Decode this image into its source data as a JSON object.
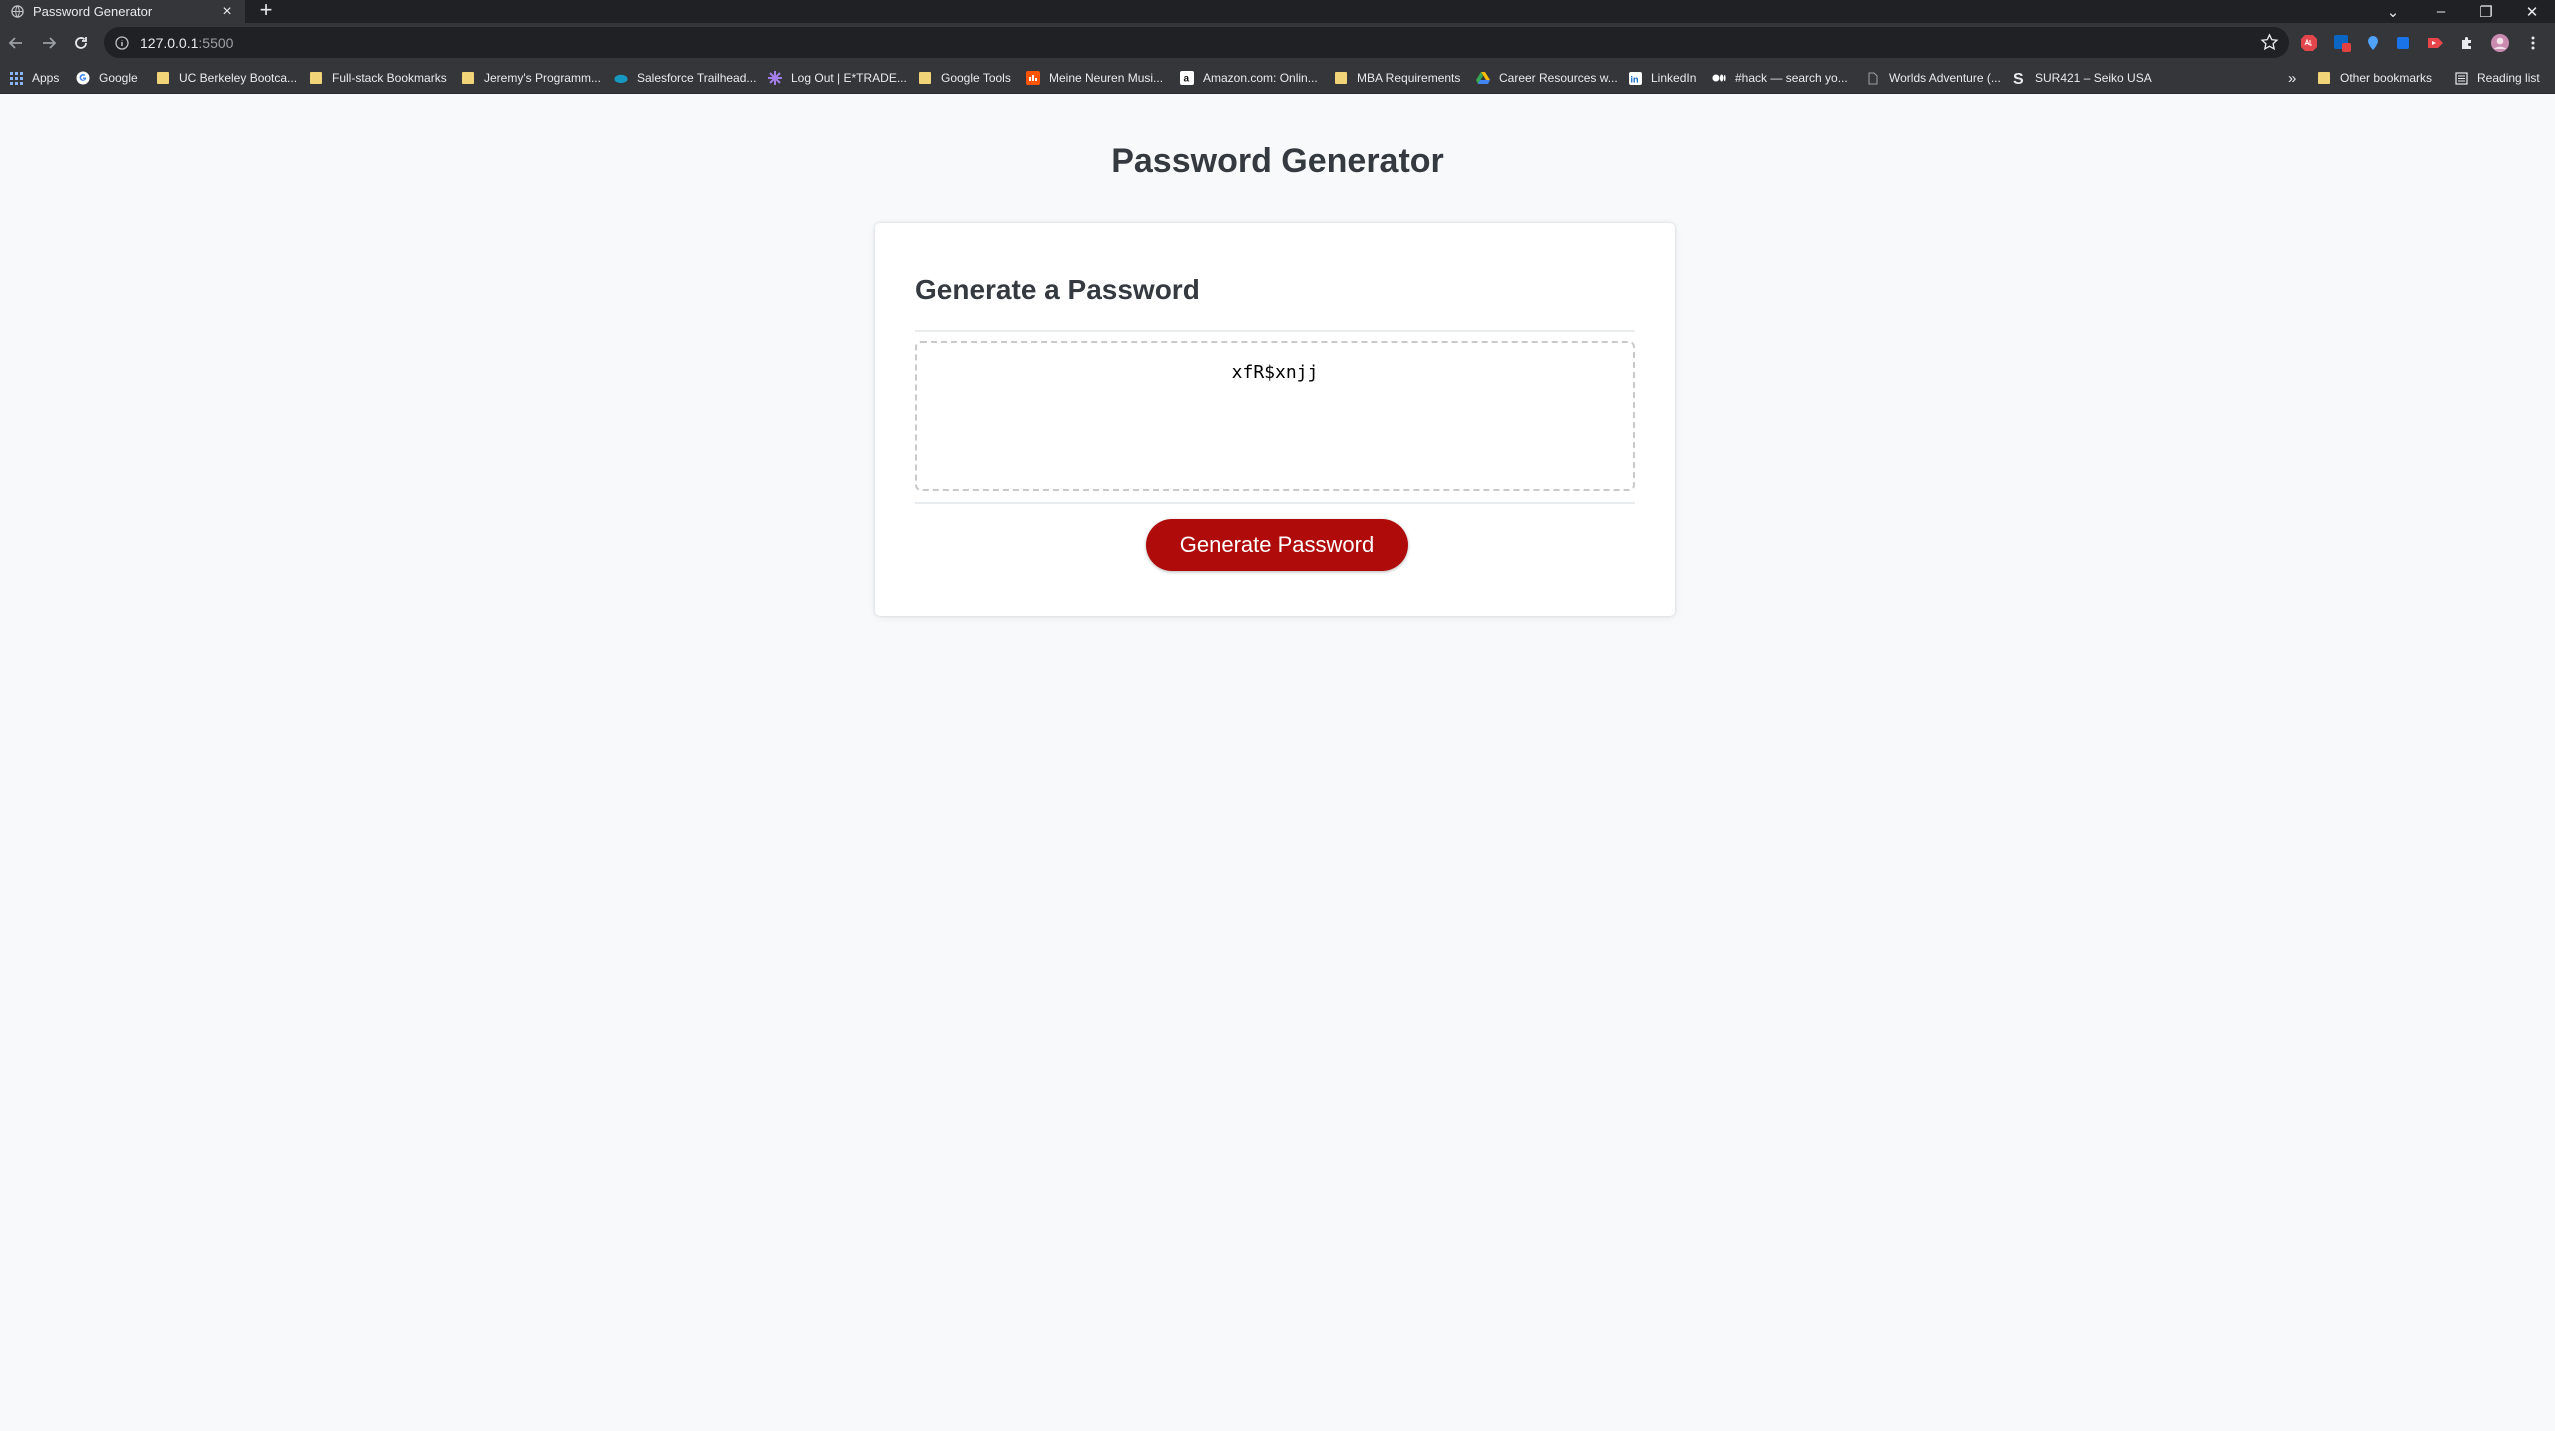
{
  "browser": {
    "tab_title": "Password Generator",
    "tab_close": "×",
    "new_tab": "+",
    "url_host": "127.0.0.1",
    "url_port": ":5500",
    "window_controls": {
      "dropdown": "⌄",
      "minimize": "–",
      "restore": "❐",
      "close": "✕"
    }
  },
  "bookmarks": {
    "items": [
      {
        "label": "Apps",
        "icon": "apps-grid-icon"
      },
      {
        "label": "Google",
        "icon": "google-icon"
      },
      {
        "label": "UC Berkeley Bootca...",
        "icon": "folder-icon"
      },
      {
        "label": "Full-stack Bookmarks",
        "icon": "folder-icon"
      },
      {
        "label": "Jeremy's Programm...",
        "icon": "folder-icon"
      },
      {
        "label": "Salesforce Trailhead...",
        "icon": "salesforce-icon"
      },
      {
        "label": "Log Out | E*TRADE...",
        "icon": "etrade-icon"
      },
      {
        "label": "Google Tools",
        "icon": "folder-icon"
      },
      {
        "label": "Meine Neuren Musi...",
        "icon": "music-icon"
      },
      {
        "label": "Amazon.com: Onlin...",
        "icon": "amazon-icon"
      },
      {
        "label": "MBA Requirements",
        "icon": "folder-icon"
      },
      {
        "label": "Career Resources w...",
        "icon": "drive-icon"
      },
      {
        "label": "LinkedIn",
        "icon": "linkedin-icon"
      },
      {
        "label": "#hack — search yo...",
        "icon": "medium-icon"
      },
      {
        "label": "Worlds Adventure (...",
        "icon": "page-icon"
      },
      {
        "label": "SUR421 – Seiko USA",
        "icon": "seiko-icon"
      }
    ],
    "overflow": "»",
    "other_bookmarks": "Other bookmarks",
    "reading_list": "Reading list"
  },
  "page": {
    "title": "Password Generator",
    "card_heading": "Generate a Password",
    "password_value": "xfR$xnjj",
    "generate_button": "Generate Password"
  },
  "colors": {
    "button": "#b00b0b",
    "page_bg": "#f8f9fb",
    "heading": "#343a40"
  }
}
